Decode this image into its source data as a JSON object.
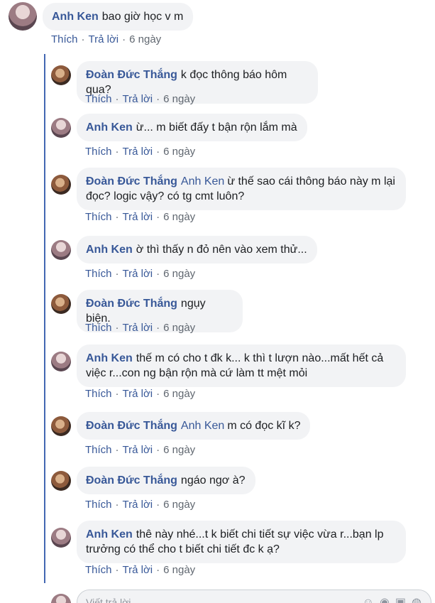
{
  "top_comment": {
    "author": "Anh Ken",
    "text": "bao giờ học v m",
    "actions": {
      "like": "Thích",
      "reply": "Trả lời",
      "time": "6 ngày"
    }
  },
  "replies": [
    {
      "author": "Đoàn Đức Thắng",
      "mention": "",
      "text": "k đọc thông báo hôm qua?",
      "like": "Thích",
      "reply": "Trả lời",
      "time": "6 ngày",
      "avatar": "doan"
    },
    {
      "author": "Anh Ken",
      "mention": "",
      "text": "ừ... m biết đấy t bận rộn lắm mà",
      "like": "Thích",
      "reply": "Trả lời",
      "time": "6 ngày",
      "avatar": "anh"
    },
    {
      "author": "Đoàn Đức Thắng",
      "mention": "Anh Ken",
      "text": "ừ thế sao cái thông báo này m lại đọc? logic vậy? có tg cmt luôn?",
      "like": "Thích",
      "reply": "Trả lời",
      "time": "6 ngày",
      "avatar": "doan"
    },
    {
      "author": "Anh Ken",
      "mention": "",
      "text": "ờ thì thấy n đỏ nên vào xem thử...",
      "like": "Thích",
      "reply": "Trả lời",
      "time": "6 ngày",
      "avatar": "anh"
    },
    {
      "author": "Đoàn Đức Thắng",
      "mention": "",
      "text": "ngụy biện.",
      "like": "Thích",
      "reply": "Trả lời",
      "time": "6 ngày",
      "avatar": "doan"
    },
    {
      "author": "Anh Ken",
      "mention": "",
      "text": "thế m có cho t đk k... k thì t lượn nào...mất hết cả việc r...con ng bận rộn mà cứ làm tt mệt mỏi",
      "like": "Thích",
      "reply": "Trả lời",
      "time": "6 ngày",
      "avatar": "anh"
    },
    {
      "author": "Đoàn Đức Thắng",
      "mention": "Anh Ken",
      "text": "m có đọc kĩ k?",
      "like": "Thích",
      "reply": "Trả lời",
      "time": "6 ngày",
      "avatar": "doan"
    },
    {
      "author": "Đoàn Đức Thắng",
      "mention": "",
      "text": "ngáo ngơ à?",
      "like": "Thích",
      "reply": "Trả lời",
      "time": "6 ngày",
      "avatar": "doan"
    },
    {
      "author": "Anh Ken",
      "mention": "",
      "text": "thê này nhé...t k biết chi tiết sự việc vừa r...bạn lp trưởng có thể cho t biết chi tiết đc k ạ?",
      "like": "Thích",
      "reply": "Trả lời",
      "time": "6 ngày",
      "avatar": "anh"
    }
  ],
  "composer": {
    "placeholder": "Viết trả lời..."
  },
  "colors": {
    "link": "#385898",
    "bubble": "#f2f3f5",
    "thread_line": "#4267b2",
    "meta": "#606770"
  }
}
